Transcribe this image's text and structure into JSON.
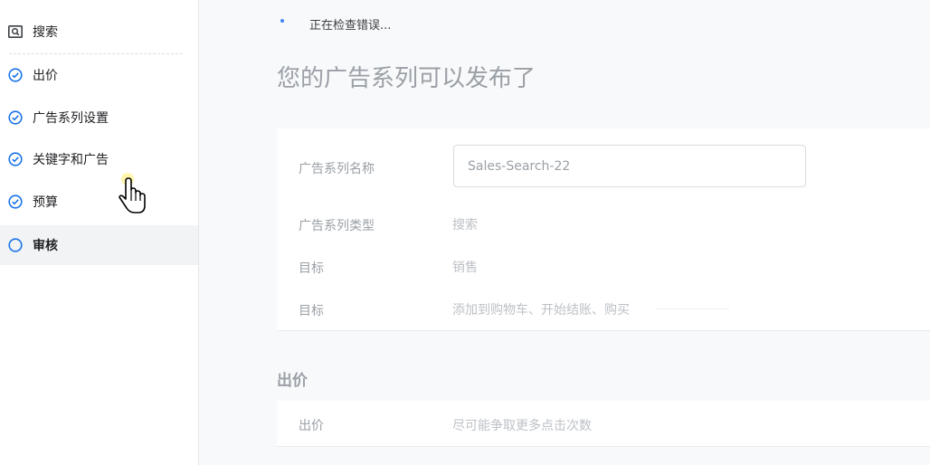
{
  "sidebar": {
    "items": [
      {
        "label": "搜索",
        "icon": "search-box-icon",
        "state": "done"
      },
      {
        "label": "出价",
        "icon": "check-circle-icon",
        "state": "done"
      },
      {
        "label": "广告系列设置",
        "icon": "check-circle-icon",
        "state": "done"
      },
      {
        "label": "关键字和广告",
        "icon": "check-circle-icon",
        "state": "done"
      },
      {
        "label": "预算",
        "icon": "check-circle-icon",
        "state": "done"
      },
      {
        "label": "审核",
        "icon": "empty-circle-icon",
        "state": "current"
      }
    ]
  },
  "status": {
    "checking": "正在检查错误..."
  },
  "main": {
    "title": "您的广告系列可以发布了",
    "settings": {
      "name_label": "广告系列名称",
      "name_value": "Sales-Search-22",
      "type_label": "广告系列类型",
      "type_value": "搜索",
      "goal_label": "目标",
      "goal_value": "销售",
      "goal2_label": "目标",
      "goal2_value": "添加到购物车、开始结账、购买"
    },
    "bidding": {
      "section_title": "出价",
      "label": "出价",
      "value": "尽可能争取更多点击次数"
    }
  },
  "colors": {
    "accent": "#1a73e8",
    "spinner": "#4285f4",
    "highlight": "#fff59d"
  }
}
